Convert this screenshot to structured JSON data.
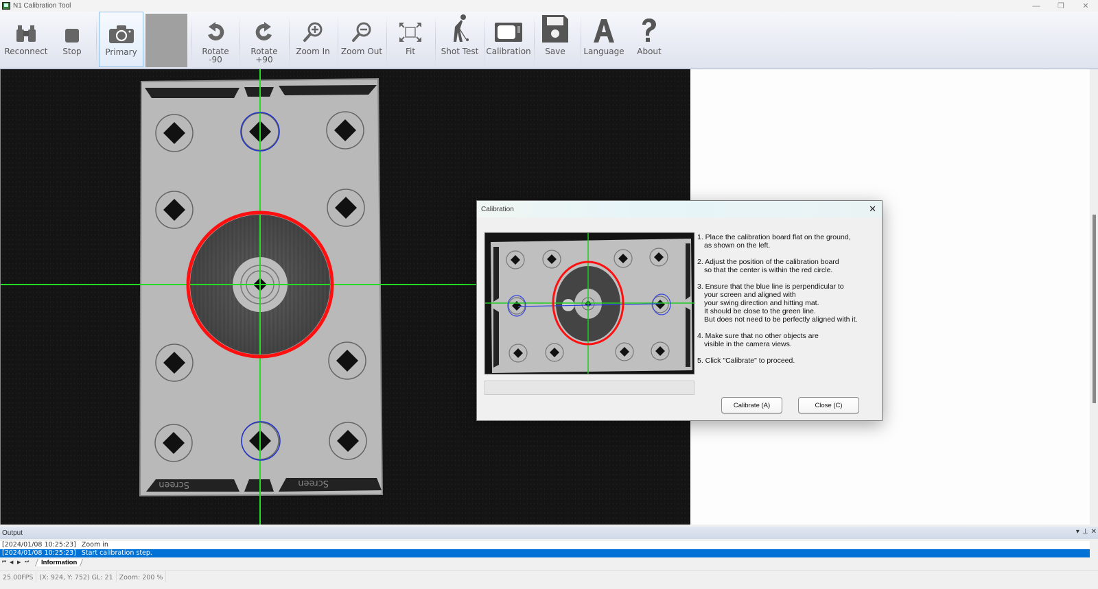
{
  "window": {
    "title": "N1 Calibration Tool",
    "controls": [
      "—",
      "❐",
      "✕"
    ]
  },
  "toolbar": {
    "buttons": [
      {
        "id": "reconnect",
        "label": "Reconnect",
        "icon": "binoculars-icon"
      },
      {
        "id": "stop",
        "label": "Stop",
        "icon": "stop-icon"
      },
      {
        "id": "primary",
        "label": "Primary",
        "icon": "camera-icon",
        "selected": true
      },
      {
        "id": "rotate-minus",
        "label": "Rotate",
        "sublabel": "-90",
        "icon": "rotate-left-icon"
      },
      {
        "id": "rotate-plus",
        "label": "Rotate",
        "sublabel": "+90",
        "icon": "rotate-right-icon"
      },
      {
        "id": "zoom-in",
        "label": "Zoom In",
        "icon": "zoom-in-icon"
      },
      {
        "id": "zoom-out",
        "label": "Zoom Out",
        "icon": "zoom-out-icon"
      },
      {
        "id": "fit",
        "label": "Fit",
        "icon": "fit-icon"
      },
      {
        "id": "shot-test",
        "label": "Shot Test",
        "icon": "golfer-icon"
      },
      {
        "id": "calibration",
        "label": "Calibration",
        "icon": "monitor-icon"
      },
      {
        "id": "save",
        "label": "Save",
        "icon": "floppy-icon"
      },
      {
        "id": "language",
        "label": "Language",
        "icon": "letter-a-icon"
      },
      {
        "id": "about",
        "label": "About",
        "icon": "question-icon"
      }
    ]
  },
  "viewer": {
    "board_labels": [
      "Screen",
      "Screen"
    ],
    "overlay_colors": {
      "crosshair": "#22dd22",
      "target_circle": "#ff1010",
      "marker_circle": "#2233cc"
    }
  },
  "dialog": {
    "title": "Calibration",
    "steps": [
      [
        "1. Place the calibration board flat on the ground,",
        "as shown on the left."
      ],
      [
        "2. Adjust the position of the calibration board",
        "so that the center is within the red circle."
      ],
      [
        "3. Ensure that the blue line is perpendicular to",
        "your screen and aligned with",
        "your swing direction and hitting mat.",
        "It should be close to the green line.",
        "But does not need to be perfectly aligned with it."
      ],
      [
        "4. Make sure that no other objects are",
        "visible in the camera views."
      ],
      [
        "5. Click \"Calibrate\" to proceed."
      ]
    ],
    "progress": 0,
    "calibrate_label": "Calibrate (A)",
    "close_label": "Close (C)"
  },
  "output": {
    "title": "Output",
    "controls": [
      "▾",
      "⊥",
      "✕"
    ],
    "entries": [
      {
        "timestamp": "[2024/01/08 10:25:23]",
        "message": "Zoom in",
        "selected": false
      },
      {
        "timestamp": "[2024/01/08 10:25:23]",
        "message": "Start calibration step.",
        "selected": true
      }
    ],
    "tab": "Information",
    "nav": [
      "⏮",
      "◀",
      "▶",
      "⏭"
    ]
  },
  "status": {
    "fps": "25.00FPS",
    "cursor": "(X: 924, Y: 752) GL: 21",
    "zoom": "Zoom: 200 %"
  }
}
